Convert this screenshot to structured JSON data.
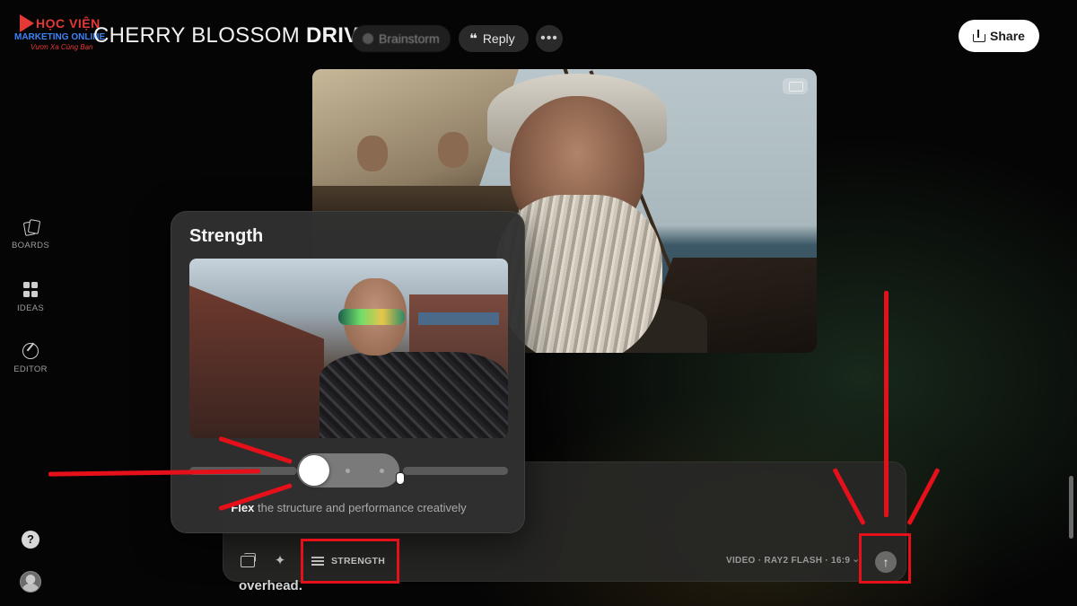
{
  "watermark": {
    "line1": "HỌC VIỆN",
    "line2": "MARKETING ONLINE",
    "line3": "Vươn Xa Cùng Bạn"
  },
  "header": {
    "title_light": "CHERRY BLOSSOM",
    "title_bold": "DRIVE",
    "chips": {
      "brainstorm": "Brainstorm",
      "reply": "Reply",
      "more": "•••"
    },
    "share_label": "Share"
  },
  "sidebar": {
    "items": [
      {
        "label": "BOARDS",
        "icon": "cards-icon"
      },
      {
        "label": "IDEAS",
        "icon": "grid-icon"
      },
      {
        "label": "EDITOR",
        "icon": "edit-icon"
      }
    ],
    "help_label": "?"
  },
  "popover": {
    "title": "Strength",
    "description_bold": "Flex",
    "description_rest": " the structure and performance creatively"
  },
  "prompt_bar": {
    "strength_label": "STRENGTH",
    "model_label": "VIDEO · RAY2 FLASH · 16:9",
    "model_chevron": "⌄",
    "send_icon": "↑",
    "overflow_text": "overhead."
  },
  "colors": {
    "annotation": "#e5101a",
    "background": "#050505",
    "share_bg": "#ffffff"
  }
}
